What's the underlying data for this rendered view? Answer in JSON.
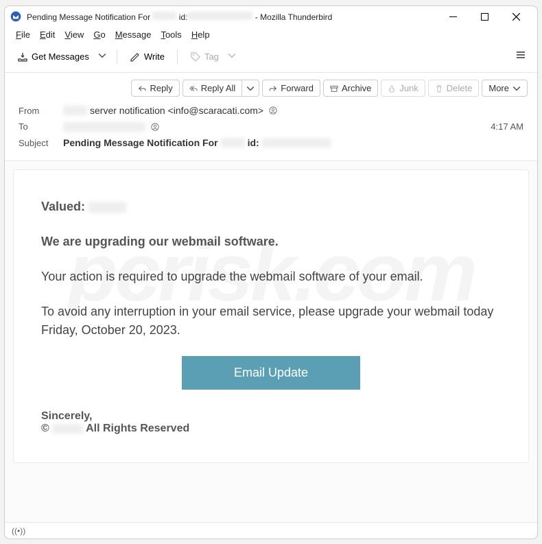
{
  "window": {
    "title_prefix": "Pending Message Notification For ",
    "title_id_label": " id:",
    "title_suffix": " - Mozilla Thunderbird"
  },
  "menubar": [
    "File",
    "Edit",
    "View",
    "Go",
    "Message",
    "Tools",
    "Help"
  ],
  "toolbar": {
    "get_messages": "Get Messages",
    "write": "Write",
    "tag": "Tag"
  },
  "actions": {
    "reply": "Reply",
    "reply_all": "Reply All",
    "forward": "Forward",
    "archive": "Archive",
    "junk": "Junk",
    "delete": "Delete",
    "more": "More"
  },
  "headers": {
    "from_label": "From",
    "from_value": " server notification <info@scaracati.com>",
    "to_label": "To",
    "subject_label": "Subject",
    "subject_prefix": "Pending Message Notification For ",
    "subject_id_label": " id:",
    "time": "4:17 AM"
  },
  "body": {
    "valued": "Valued: ",
    "upgrading": "We are upgrading our webmail software.",
    "action": "Your action is required to upgrade the webmail software of your email.",
    "avoid": "To avoid any interruption in your email service, please upgrade your webmail today Friday, October 20, 2023.",
    "button": "Email Update",
    "sincerely": "Sincerely,",
    "copyright_prefix": "© ",
    "copyright_suffix": " All Rights Reserved"
  },
  "status": {
    "offline_icon": "((•))"
  },
  "watermark": "pcrisk.com"
}
